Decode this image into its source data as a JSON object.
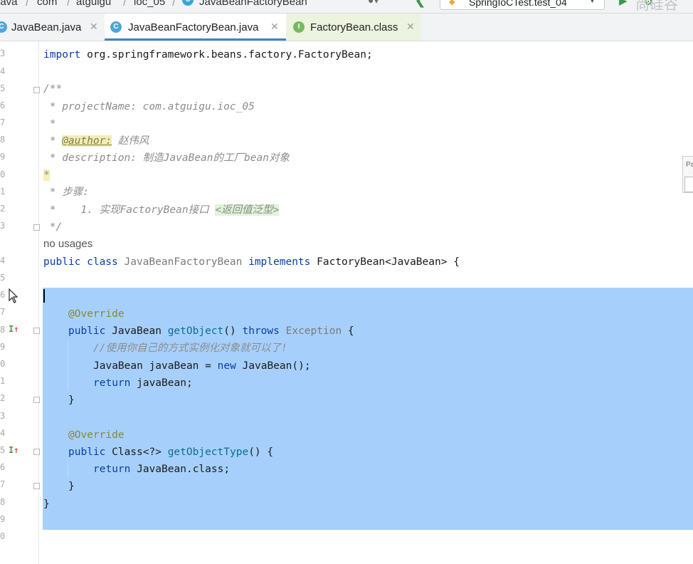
{
  "breadcrumb": {
    "items": [
      "java",
      "com",
      "atguigu",
      "ioc_05",
      "JavaBeanFactoryBean"
    ],
    "class_icon": "C"
  },
  "toolbar": {
    "run_config_label": "SpringIoCTest.test_04",
    "watermark": "尚硅谷"
  },
  "tabs": [
    {
      "label": "JavaBean.java",
      "icon": "C",
      "active": false
    },
    {
      "label": "JavaBeanFactoryBean.java",
      "icon": "C",
      "active": true
    },
    {
      "label": "FactoryBean.class",
      "icon": "I",
      "active": false
    }
  ],
  "editor": {
    "line_numbers": [
      "3",
      "4",
      "5",
      "6",
      "7",
      "8",
      "9",
      "0",
      "1",
      "2",
      "3",
      "",
      "4",
      "5",
      "6",
      "7",
      "8",
      "9",
      "0",
      "1",
      "2",
      "3",
      "4",
      "5",
      "6",
      "7",
      "8",
      "9",
      "0"
    ],
    "lines": {
      "import_kw": "import",
      "import_path": " org.springframework.beans.factory.FactoryBean;",
      "doc_open": "/**",
      "doc_project": " * projectName: com.atguigu.ioc_05",
      "doc_star": " *",
      "doc_star_prefix": " * ",
      "doc_author_tag": "@author:",
      "doc_author_name": " 赵伟风",
      "doc_description": " * description: 制造JavaBean的工厂bean对象",
      "doc_star_hl": "*",
      "doc_steps": " * 步骤:",
      "doc_step1": " *    1. 实现FactoryBean接口 ",
      "doc_step1_generic": "<返回值泛型>",
      "doc_close": " */",
      "usages_hint": "no usages",
      "class_kw1": "public class",
      "class_name": " JavaBeanFactoryBean ",
      "class_kw2": "implements",
      "class_rest": " FactoryBean<JavaBean> {",
      "override1": "@Override",
      "getobj_kw": "public",
      "getobj_type": " JavaBean ",
      "getobj_method": "getObject",
      "getobj_parens": "() ",
      "getobj_throws": "throws",
      "getobj_exc": " Exception",
      "getobj_brace": " {",
      "body_comment": "//使用你自己的方式实例化对象就可以了!",
      "body_decl": "JavaBean javaBean = ",
      "body_new": "new",
      "body_ctor": " JavaBean();",
      "body_return_kw": "return",
      "body_return_val": " javaBean;",
      "close_brace": "}",
      "override2": "@Override",
      "gettype_kw": "public",
      "gettype_type": " Class<?> ",
      "gettype_method": "getObjectType",
      "gettype_rest": "() {",
      "gettype_return_kw": "return",
      "gettype_return_val": " JavaBean.class;",
      "class_close": "}"
    }
  },
  "popup_stub_text": "Pa"
}
